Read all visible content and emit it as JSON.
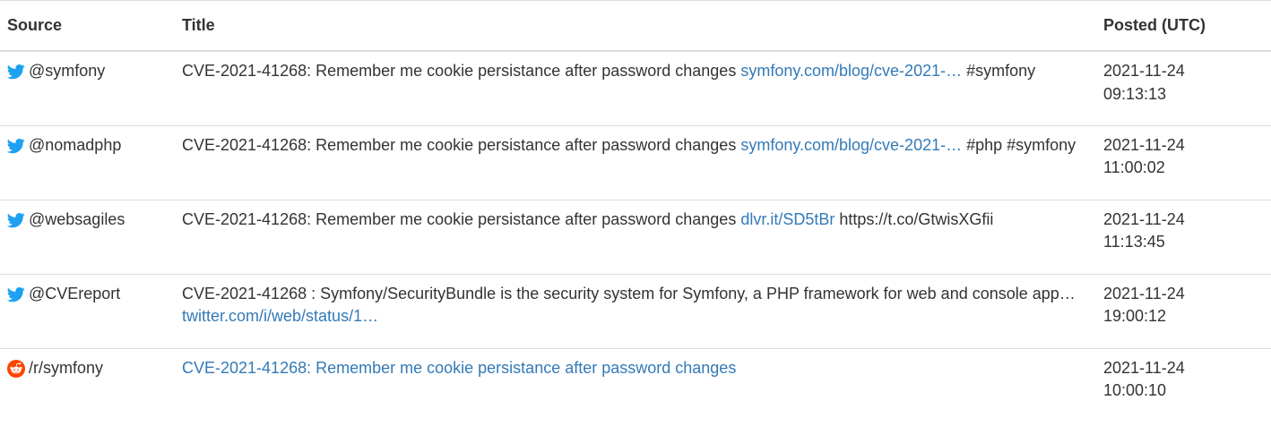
{
  "colors": {
    "text": "#333333",
    "link": "#337ab7",
    "twitter": "#1da1f2",
    "reddit": "#ff4500",
    "border": "#dddddd"
  },
  "table": {
    "headers": {
      "source": "Source",
      "title": "Title",
      "posted": "Posted (UTC)"
    },
    "rows": [
      {
        "icon": "twitter-icon",
        "source": "@symfony",
        "title_text": "CVE-2021-41268: Remember me cookie persistance after password changes ",
        "title_link": "symfony.com/blog/cve-2021-…",
        "title_tail": " #symfony",
        "date": "2021-11-24",
        "time": "09:13:13"
      },
      {
        "icon": "twitter-icon",
        "source": "@nomadphp",
        "title_text": "CVE-2021-41268: Remember me cookie persistance after password changes ",
        "title_link": "symfony.com/blog/cve-2021-…",
        "title_tail": " #php #symfony",
        "date": "2021-11-24",
        "time": "11:00:02"
      },
      {
        "icon": "twitter-icon",
        "source": "@websagiles",
        "title_text": "CVE-2021-41268: Remember me cookie persistance after password changes ",
        "title_link": "dlvr.it/SD5tBr",
        "title_tail": " https://t.co/GtwisXGfii",
        "date": "2021-11-24",
        "time": "11:13:45"
      },
      {
        "icon": "twitter-icon",
        "source": "@CVEreport",
        "title_text": "CVE-2021-41268 : Symfony/SecurityBundle is the security system for Symfony, a PHP framework for web and console app… ",
        "title_link": "twitter.com/i/web/status/1…",
        "title_tail": "",
        "date": "2021-11-24",
        "time": "19:00:12"
      },
      {
        "icon": "reddit-icon",
        "source": "/r/symfony",
        "title_text": "",
        "title_link": "CVE-2021-41268: Remember me cookie persistance after password changes",
        "title_tail": "",
        "date": "2021-11-24",
        "time": "10:00:10"
      }
    ]
  }
}
